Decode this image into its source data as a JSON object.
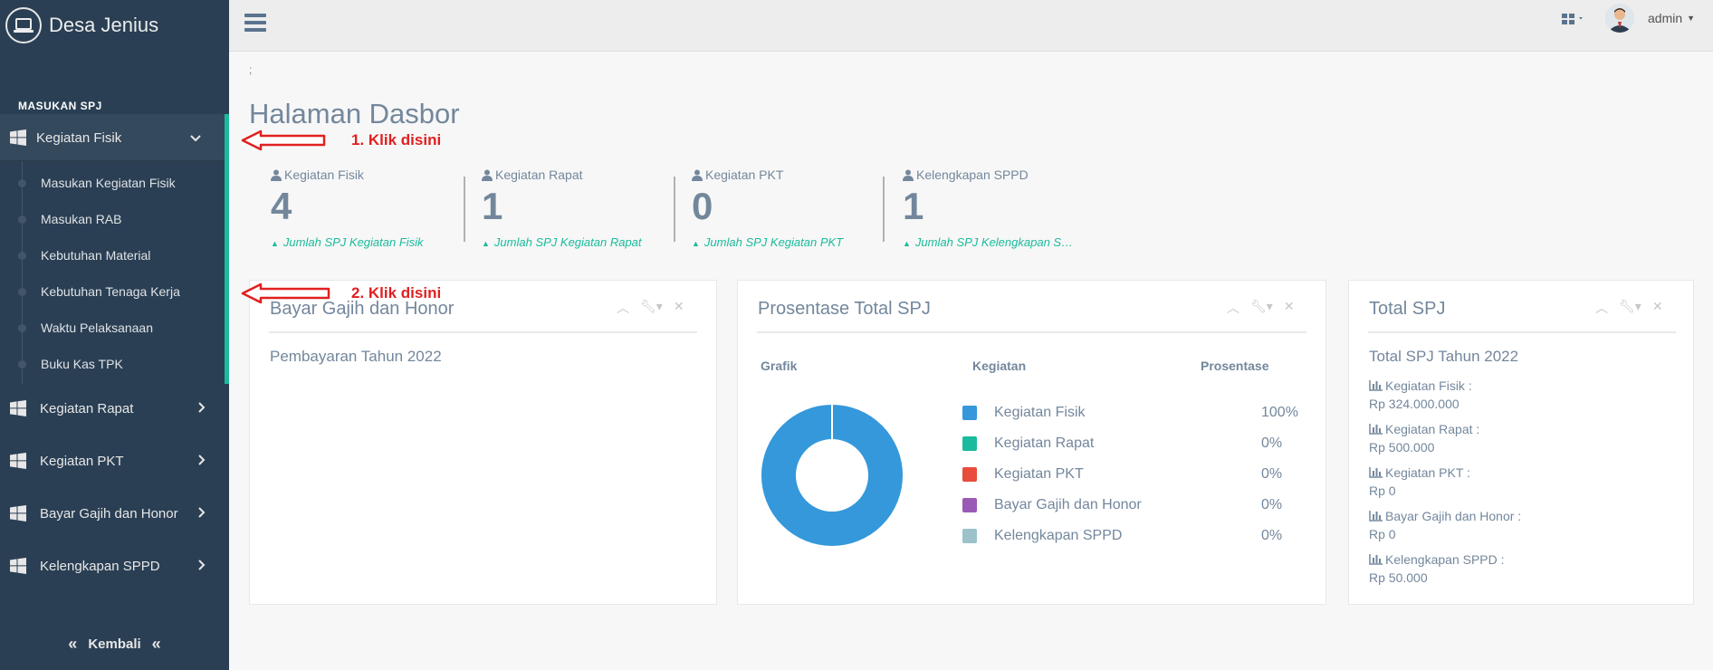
{
  "brand": {
    "title": "Desa Jenius"
  },
  "sidebar": {
    "section_label": "MASUKAN SPJ",
    "active_item": {
      "label": "Kegiatan Fisik",
      "icon": "windows-icon"
    },
    "sub_items": [
      {
        "label": "Masukan Kegiatan Fisik"
      },
      {
        "label": "Masukan RAB"
      },
      {
        "label": "Kebutuhan Material"
      },
      {
        "label": "Kebutuhan Tenaga Kerja"
      },
      {
        "label": "Waktu Pelaksanaan"
      },
      {
        "label": "Buku Kas TPK"
      }
    ],
    "items": [
      {
        "label": "Kegiatan Rapat"
      },
      {
        "label": "Kegiatan PKT"
      },
      {
        "label": "Bayar Gajih dan Honor"
      },
      {
        "label": "Kelengkapan SPPD"
      }
    ],
    "back_label": "Kembali"
  },
  "topnav": {
    "user_name": "admin"
  },
  "page": {
    "semicolon": ";",
    "title": "Halaman Dasbor"
  },
  "stats": [
    {
      "label": "Kegiatan Fisik",
      "count": "4",
      "footer": "Jumlah SPJ Kegiatan Fisik"
    },
    {
      "label": "Kegiatan Rapat",
      "count": "1",
      "footer": "Jumlah SPJ Kegiatan Rapat"
    },
    {
      "label": "Kegiatan PKT",
      "count": "0",
      "footer": "Jumlah SPJ Kegiatan PKT"
    },
    {
      "label": "Kelengkapan SPPD",
      "count": "1",
      "footer": "Jumlah SPJ Kelengkapan SPPD"
    }
  ],
  "panels": {
    "gaji": {
      "title": "Bayar Gajih dan Honor",
      "subtitle": "Pembayaran Tahun 2022"
    },
    "prosentase": {
      "title": "Prosentase Total SPJ",
      "col_grafik": "Grafik",
      "col_kegiatan": "Kegiatan",
      "col_prosentase": "Prosentase",
      "rows": [
        {
          "label": "Kegiatan Fisik",
          "value": "100%",
          "color": "#3498db"
        },
        {
          "label": "Kegiatan Rapat",
          "value": "0%",
          "color": "#1abb9c"
        },
        {
          "label": "Kegiatan PKT",
          "value": "0%",
          "color": "#e74c3c"
        },
        {
          "label": "Bayar Gajih dan Honor",
          "value": "0%",
          "color": "#9b59b6"
        },
        {
          "label": "Kelengkapan SPPD",
          "value": "0%",
          "color": "#9cc2cb"
        }
      ]
    },
    "total": {
      "title": "Total SPJ",
      "subtitle": "Total SPJ Tahun 2022",
      "items": [
        {
          "label": "Kegiatan Fisik :",
          "amount": "Rp 324.000.000"
        },
        {
          "label": "Kegiatan Rapat :",
          "amount": "Rp 500.000"
        },
        {
          "label": "Kegiatan PKT :",
          "amount": "Rp 0"
        },
        {
          "label": "Bayar Gajih dan Honor :",
          "amount": "Rp 0"
        },
        {
          "label": "Kelengkapan SPPD :",
          "amount": "Rp 50.000"
        }
      ]
    }
  },
  "annotations": {
    "step1": "1. Klik disini",
    "step2": "2. Klik disini"
  },
  "colors": {
    "sidebar_bg": "#2a3f54",
    "accent": "#1abb9c",
    "annotation": "#e02020"
  }
}
